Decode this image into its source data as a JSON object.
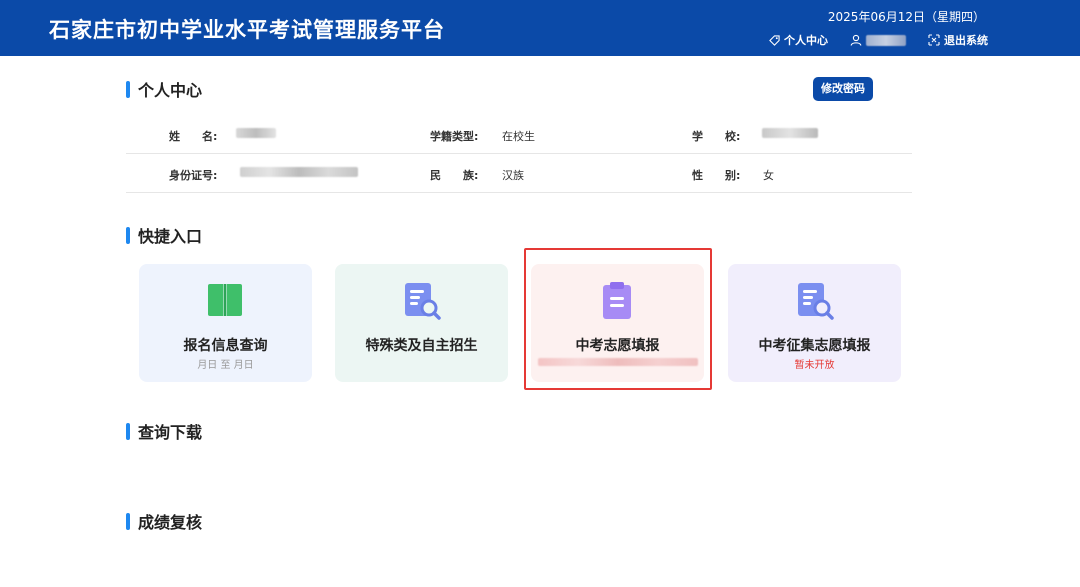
{
  "header": {
    "title": "石家庄市初中学业水平考试管理服务平台",
    "date": "2025年06月12日（星期四）",
    "nav": {
      "personal_center": "个人中心",
      "logout": "退出系统"
    }
  },
  "personal": {
    "section_title": "个人中心",
    "change_password": "修改密码",
    "fields": {
      "name_label": "姓　　名:",
      "status_label": "学籍类型:",
      "status_value": "在校生",
      "school_label": "学　　校:",
      "id_label": "身份证号:",
      "ethnicity_label": "民　　族:",
      "ethnicity_value": "汉族",
      "gender_label": "性　　别:",
      "gender_value": "女"
    }
  },
  "quick": {
    "section_title": "快捷入口",
    "cards": [
      {
        "name": "报名信息查询",
        "sub": "月日 至 月日",
        "icon": "book-icon"
      },
      {
        "name": "特殊类及自主招生",
        "sub": "",
        "icon": "document-search-icon"
      },
      {
        "name": "中考志愿填报",
        "sub": "",
        "icon": "clipboard-icon"
      },
      {
        "name": "中考征集志愿填报",
        "sub": "暂未开放",
        "icon": "document-search-icon"
      }
    ]
  },
  "query": {
    "section_title": "查询下载"
  },
  "review": {
    "section_title": "成绩复核"
  },
  "colors": {
    "header_bg": "#0b4aa8",
    "accent_bar": "#1e88f0",
    "highlight": "#e53935"
  }
}
